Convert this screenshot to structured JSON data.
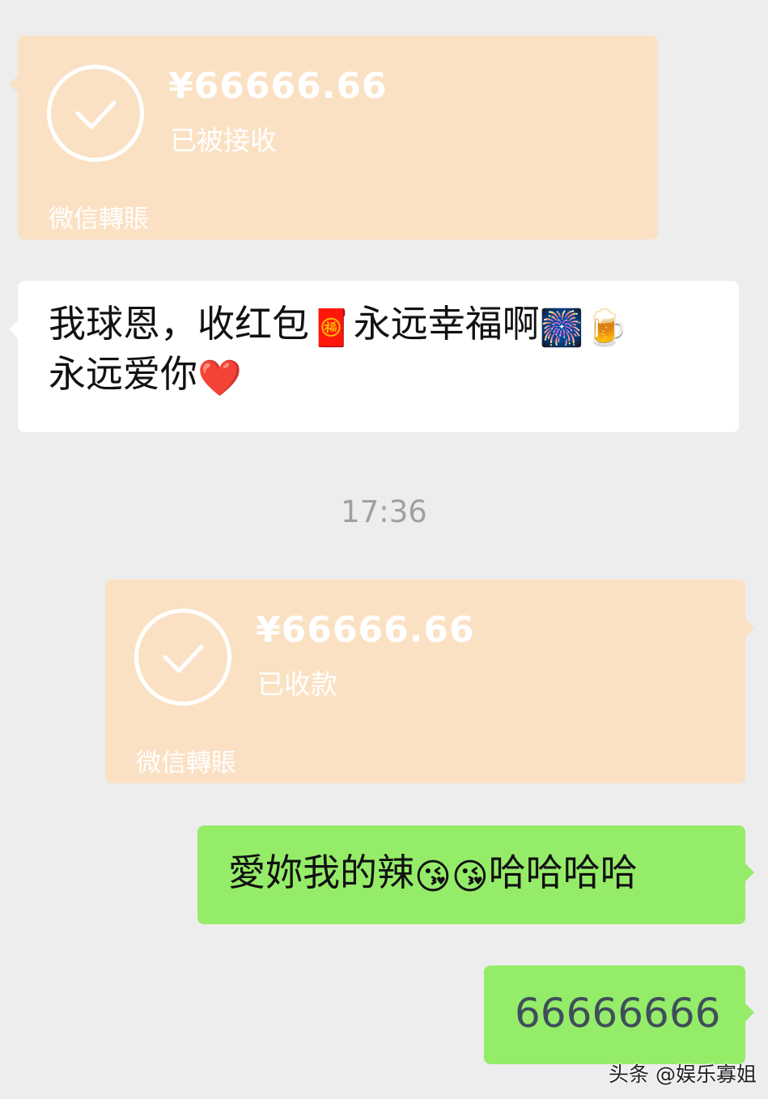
{
  "colors": {
    "background": "#ededed",
    "transfer_card": "#fbe1c4",
    "incoming_bubble": "#ffffff",
    "outgoing_bubble": "#95ec69",
    "timestamp_text": "#a0a0a0"
  },
  "messages": {
    "transfer_received": {
      "icon": "check-circle-icon",
      "amount": "¥66666.66",
      "status": "已被接收",
      "label": "微信轉賬"
    },
    "incoming_text": {
      "line1_part1": "我球恩，收红包",
      "emoji_red_envelope": "🧧",
      "line1_part2": "永远幸福啊",
      "emoji_fireworks": "🎆",
      "emoji_beer": "🍺",
      "line2_text": "永远爱你",
      "emoji_heart": "❤️"
    },
    "timestamp": "17:36",
    "transfer_sent": {
      "icon": "check-circle-icon",
      "amount": "¥66666.66",
      "status": "已收款",
      "label": "微信轉賬"
    },
    "outgoing_text_1": {
      "text_part1": "愛妳我的辣",
      "emoji_kiss_1": "😘",
      "emoji_kiss_2": "😘",
      "text_part2": "哈哈哈哈"
    },
    "outgoing_text_2": {
      "text": "66666666"
    }
  },
  "watermark": {
    "text": "头条 @娱乐寡姐"
  }
}
